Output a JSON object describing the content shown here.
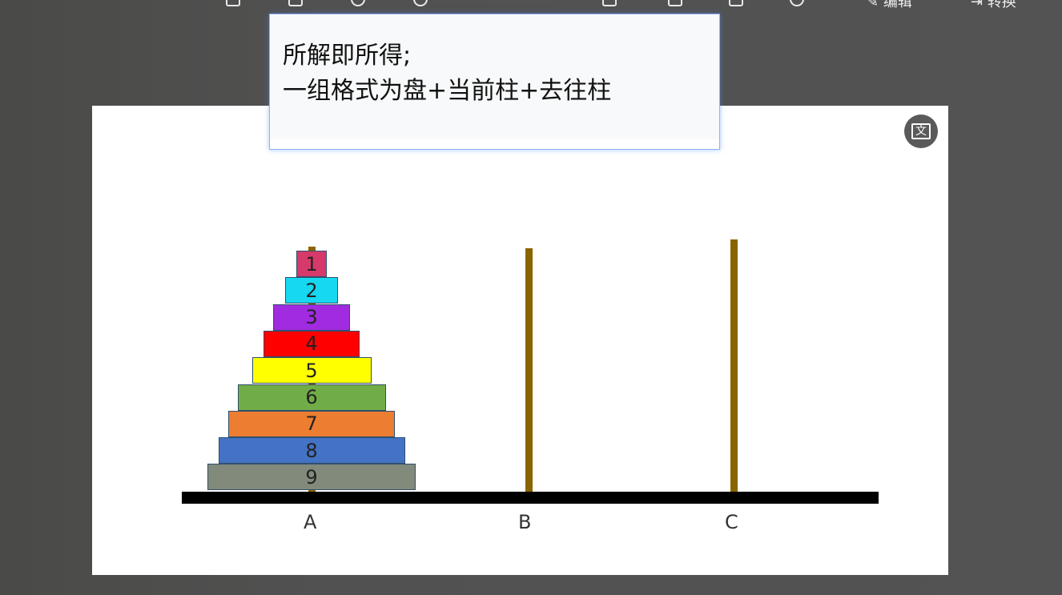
{
  "toolbar": {
    "edit_label": "编辑",
    "convert_label": "转换"
  },
  "tooltip": {
    "line1": "所解即所得;",
    "line2": "一组格式为盘+当前柱+去往柱"
  },
  "translate_button": {
    "label": "文"
  },
  "hanoi": {
    "pegs": [
      "A",
      "B",
      "C"
    ],
    "disks": [
      {
        "n": "1",
        "color": "#d63a6a"
      },
      {
        "n": "2",
        "color": "#16d8f0"
      },
      {
        "n": "3",
        "color": "#a12be0"
      },
      {
        "n": "4",
        "color": "#ff0000"
      },
      {
        "n": "5",
        "color": "#ffff00"
      },
      {
        "n": "6",
        "color": "#70ad47"
      },
      {
        "n": "7",
        "color": "#ed7d31"
      },
      {
        "n": "8",
        "color": "#4472c4"
      },
      {
        "n": "9",
        "color": "#828a7c"
      }
    ]
  }
}
